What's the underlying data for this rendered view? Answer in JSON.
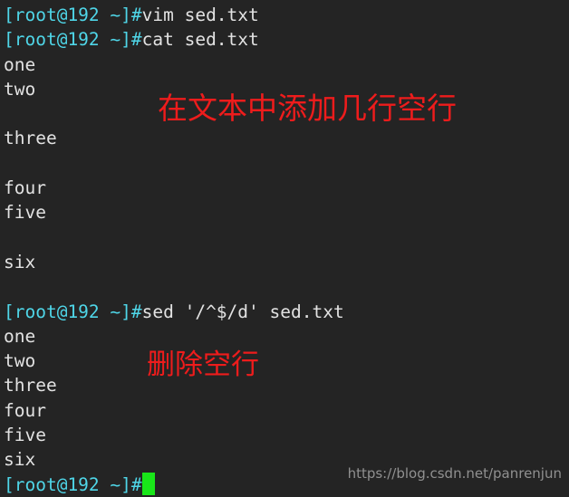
{
  "terminal": {
    "background_color": "#242424",
    "prompt_color": "#4fd6e8",
    "text_color": "#e2e2e2",
    "cursor_color": "#19e619",
    "annotation_color": "#ee1c1c",
    "prompt": "[root@192 ~]#",
    "lines": [
      {
        "kind": "prompt",
        "prompt": "[root@192 ~]#",
        "command": "vim sed.txt"
      },
      {
        "kind": "prompt",
        "prompt": "[root@192 ~]#",
        "command": "cat sed.txt"
      },
      {
        "kind": "output",
        "text": "one"
      },
      {
        "kind": "output",
        "text": "two"
      },
      {
        "kind": "blank",
        "text": ""
      },
      {
        "kind": "output",
        "text": "three"
      },
      {
        "kind": "blank",
        "text": ""
      },
      {
        "kind": "output",
        "text": "four"
      },
      {
        "kind": "output",
        "text": "five"
      },
      {
        "kind": "blank",
        "text": ""
      },
      {
        "kind": "output",
        "text": "six"
      },
      {
        "kind": "blank",
        "text": ""
      },
      {
        "kind": "prompt",
        "prompt": "[root@192 ~]#",
        "command": "sed '/^$/d' sed.txt"
      },
      {
        "kind": "output",
        "text": "one"
      },
      {
        "kind": "output",
        "text": "two"
      },
      {
        "kind": "output",
        "text": "three"
      },
      {
        "kind": "output",
        "text": "four"
      },
      {
        "kind": "output",
        "text": "five"
      },
      {
        "kind": "output",
        "text": "six"
      },
      {
        "kind": "prompt-cursor",
        "prompt": "[root@192 ~]#",
        "command": ""
      }
    ]
  },
  "annotations": [
    {
      "text": "在文本中添加几行空行"
    },
    {
      "text": "删除空行"
    }
  ],
  "watermark": {
    "text": "https://blog.csdn.net/panrenjun"
  }
}
